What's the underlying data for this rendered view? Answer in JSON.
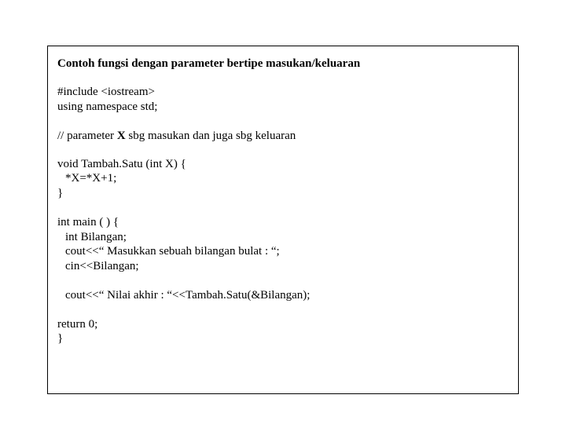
{
  "title": "Contoh fungsi dengan parameter bertipe masukan/keluaran",
  "includes": {
    "line1": "#include <iostream>",
    "line2": "using namespace std;"
  },
  "comment": {
    "prefix": "// ",
    "text1": "parameter ",
    "bold": "X",
    "text2": " sbg masukan dan juga sbg keluaran"
  },
  "func": {
    "line1": "void Tambah.Satu (int X) {",
    "line2": "*X=*X+1;",
    "line3": "}"
  },
  "main": {
    "line1": "int main ( ) {",
    "line2": "int Bilangan;",
    "line3": "cout<<“ Masukkan sebuah bilangan bulat : “;",
    "line4": "cin<<Bilangan;",
    "line5": "cout<<“ Nilai akhir : “<<Tambah.Satu(&Bilangan);"
  },
  "ret": {
    "line1": "return 0;",
    "line2": "}"
  }
}
